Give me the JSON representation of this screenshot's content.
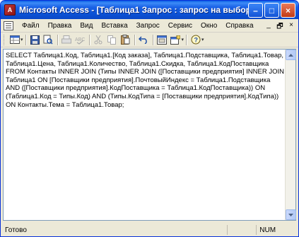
{
  "window": {
    "title": "Microsoft Access - [Таблица1 Запрос : запрос на выборку]",
    "app_icon_letter": "A",
    "minimize_glyph": "–",
    "maximize_glyph": "□",
    "close_glyph": "×"
  },
  "menubar": {
    "items": [
      {
        "label": "Файл"
      },
      {
        "label": "Правка"
      },
      {
        "label": "Вид"
      },
      {
        "label": "Вставка"
      },
      {
        "label": "Запрос"
      },
      {
        "label": "Сервис"
      },
      {
        "label": "Окно"
      },
      {
        "label": "Справка"
      }
    ],
    "mdi_minimize_glyph": "_",
    "mdi_restore_glyph": "🗗",
    "mdi_close_glyph": "×"
  },
  "toolbar": {
    "icons": [
      "view-icon",
      "save-icon",
      "print-preview-icon",
      "print-icon",
      "spelling-icon",
      "cut-icon",
      "copy-icon",
      "paste-icon",
      "undo-icon",
      "database-window-icon",
      "new-object-icon",
      "help-icon"
    ]
  },
  "editor": {
    "sql": "SELECT Таблица1.Код, Таблица1.[Код заказа], Таблица1.Подставщика, Таблица1.Товар, Таблица1.Цена, Таблица1.Количество, Таблица1.Скидка, Таблица1.КодПоставщика\nFROM Контакты INNER JOIN (Типы INNER JOIN ([Поставщики предприятия] INNER JOIN Таблица1 ON [Поставщики предприятия].ПочтовыйИндекс = Таблица1.Подставщика AND ([Поставщики предприятия].КодПоставщика = Таблица1.КодПоставщика)) ON (Таблица1.Код = Типы.Код) AND (Типы.КодТипа = [Поставщики предприятия].КодТипа)) ON Контакты.Тема = Таблица1.Товар;"
  },
  "statusbar": {
    "status_text": "Готово",
    "num_indicator": "NUM"
  }
}
